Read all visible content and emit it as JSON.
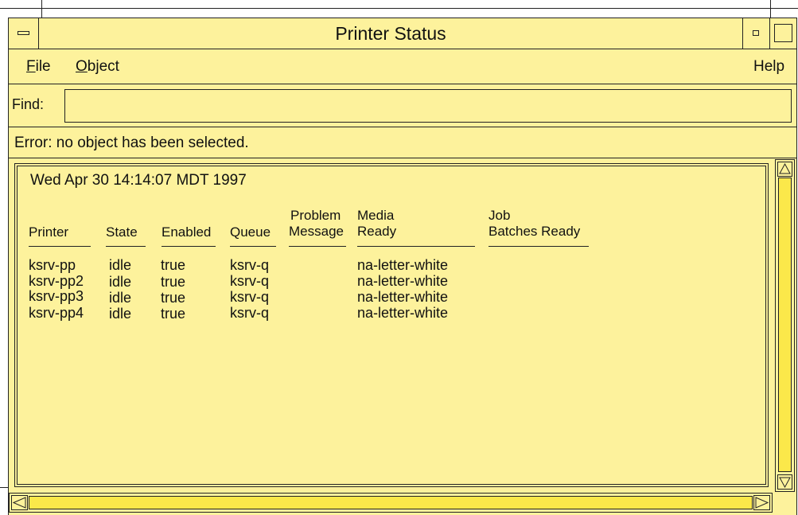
{
  "window": {
    "title": "Printer Status"
  },
  "menubar": {
    "file": {
      "mnemonic": "F",
      "rest": "ile"
    },
    "object": {
      "mnemonic": "O",
      "rest": "bject"
    },
    "help": "Help"
  },
  "find": {
    "label": "Find:",
    "value": ""
  },
  "status": {
    "message": "Error:  no object has been selected."
  },
  "report": {
    "timestamp": "Wed Apr 30 14:14:07 MDT 1997",
    "columns": {
      "printer": "Printer",
      "state": "State",
      "enabled": "Enabled",
      "queue": "Queue",
      "problem_line1": "Problem",
      "problem_line2": "Message",
      "media_line1": "Media",
      "media_line2": "Ready",
      "job_line1": "Job",
      "job_line2": "Batches Ready"
    },
    "rows": [
      {
        "printer": "ksrv-pp",
        "state": "idle",
        "enabled": "true",
        "queue": "ksrv-q",
        "problem": "",
        "media": "na-letter-white",
        "job": ""
      },
      {
        "printer": "ksrv-pp2",
        "state": "idle",
        "enabled": "true",
        "queue": "ksrv-q",
        "problem": "",
        "media": "na-letter-white",
        "job": ""
      },
      {
        "printer": "ksrv-pp3",
        "state": "idle",
        "enabled": "true",
        "queue": "ksrv-q",
        "problem": "",
        "media": "na-letter-white",
        "job": ""
      },
      {
        "printer": "ksrv-pp4",
        "state": "idle",
        "enabled": "true",
        "queue": "ksrv-q",
        "problem": "",
        "media": "na-letter-white",
        "job": ""
      }
    ]
  },
  "colors": {
    "window_bg": "#fdf29c",
    "scroll_track": "#fbe84a",
    "border": "#222222"
  }
}
